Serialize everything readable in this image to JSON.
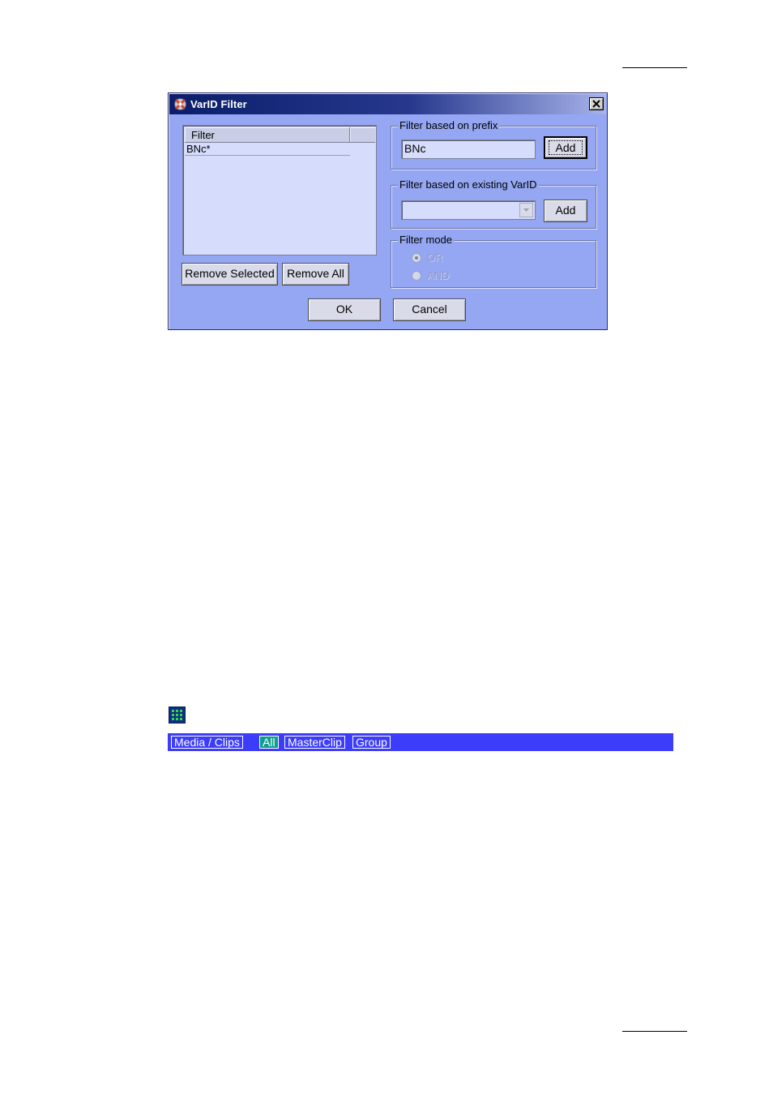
{
  "dialog": {
    "title": "VarID Filter",
    "filter_list": {
      "header": "Filter",
      "rows": [
        "BNc*"
      ]
    },
    "remove_selected_label": "Remove Selected",
    "remove_all_label": "Remove All",
    "prefix_group": {
      "label": "Filter based on prefix",
      "value": "BNc",
      "add_label": "Add"
    },
    "existing_group": {
      "label": "Filter based on existing VarID",
      "selected": "",
      "add_label": "Add"
    },
    "mode_group": {
      "label": "Filter mode",
      "options": [
        "OR",
        "AND"
      ],
      "selected": "OR"
    },
    "ok_label": "OK",
    "cancel_label": "Cancel"
  },
  "toolbar": {
    "items": [
      "Media / Clips",
      "All",
      "MasterClip",
      "Group"
    ],
    "active": "All"
  },
  "colors": {
    "dialog_bg": "#95a6f2",
    "toolbar_bg": "#3c3cfb",
    "active_tab": "#0e9d8f"
  }
}
